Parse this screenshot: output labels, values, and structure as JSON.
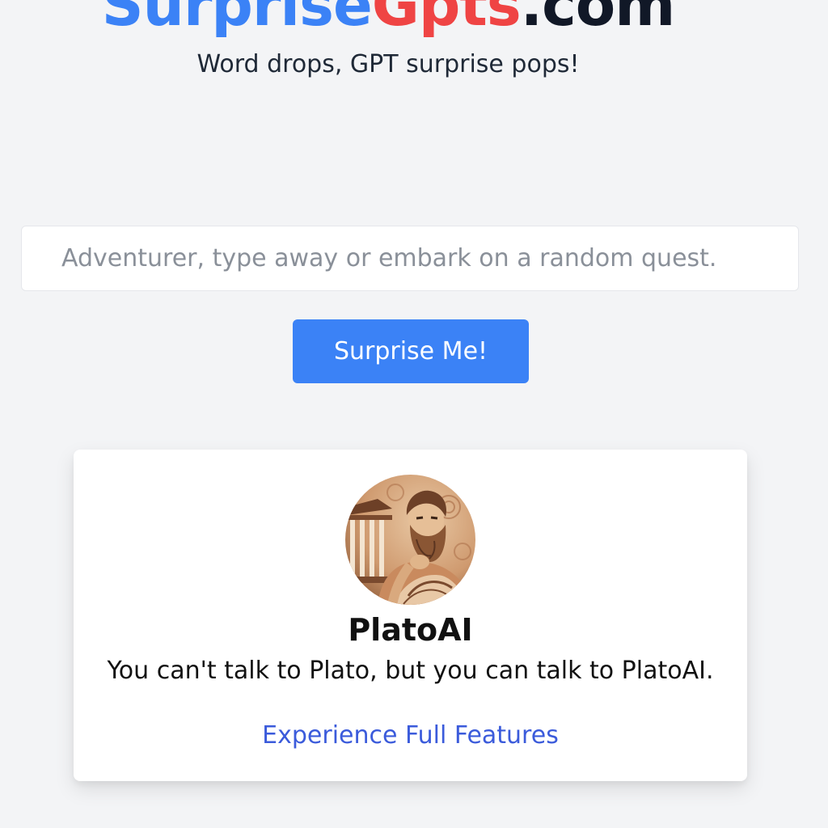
{
  "header": {
    "logo_part1": "Surprise",
    "logo_part2": "Gpts",
    "logo_part3": ".com",
    "tagline": "Word drops, GPT surprise pops!"
  },
  "search": {
    "value": "",
    "placeholder": "Adventurer, type away or embark on a random quest."
  },
  "actions": {
    "surprise_label": "Surprise Me!"
  },
  "card": {
    "avatar_icon": "plato-portrait-avatar",
    "title": "PlatoAI",
    "description": "You can't talk to Plato, but you can talk to PlatoAI.",
    "link_label": "Experience Full Features"
  },
  "colors": {
    "background": "#f3f4f6",
    "accent_blue": "#3b82f6",
    "accent_red": "#ef4444",
    "link": "#3b5bdb"
  }
}
